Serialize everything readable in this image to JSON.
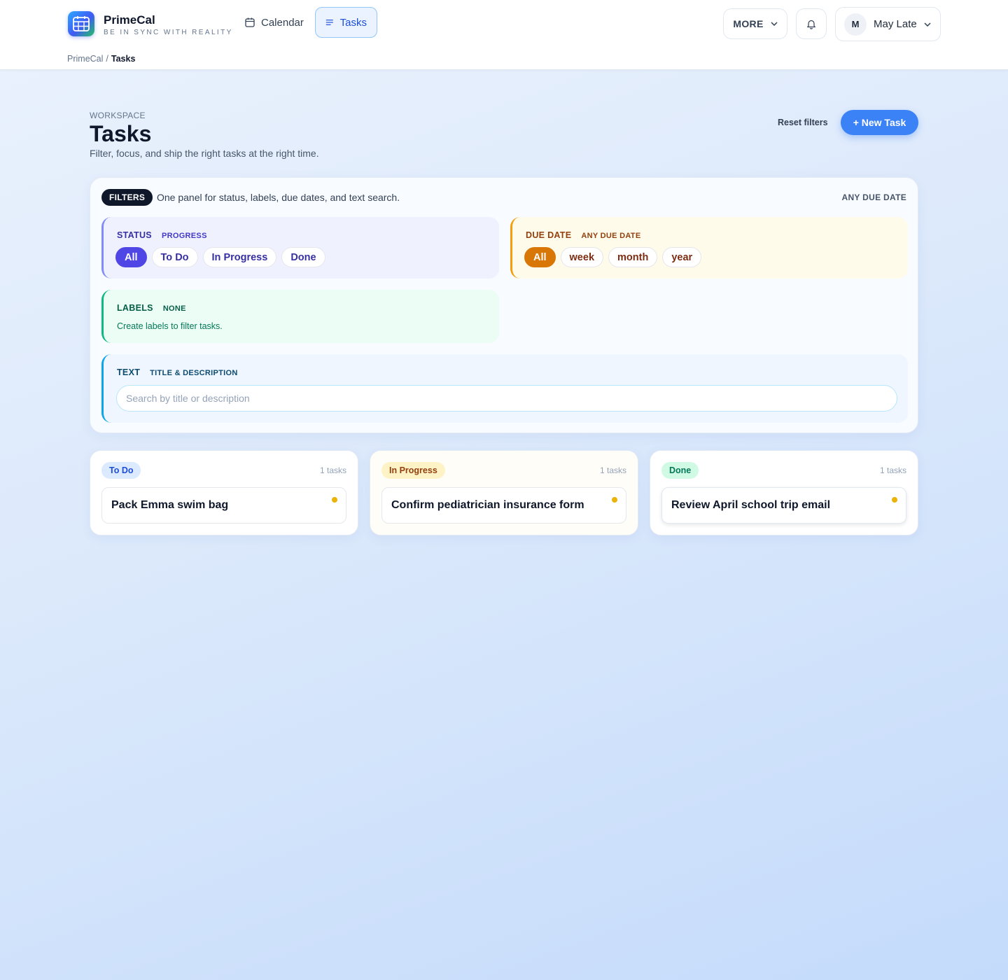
{
  "header": {
    "brand_name": "PrimeCal",
    "brand_tagline": "BE IN SYNC WITH REALITY",
    "nav": [
      {
        "label": "Calendar",
        "icon": "calendar-icon"
      },
      {
        "label": "Tasks",
        "icon": "list-icon",
        "active": true
      }
    ],
    "more_label": "MORE",
    "user": {
      "initial": "M",
      "name": "May Late"
    }
  },
  "breadcrumb": {
    "root": "PrimeCal",
    "separator": "/",
    "current": "Tasks"
  },
  "page": {
    "eyebrow": "WORKSPACE",
    "title": "Tasks",
    "subtitle": "Filter, focus, and ship the right tasks at the right time.",
    "reset_label": "Reset filters",
    "new_task_label": "+ New Task"
  },
  "filters": {
    "pill": "FILTERS",
    "description": "One panel for status, labels, due dates, and text search.",
    "summary": "ANY DUE DATE",
    "status": {
      "title": "STATUS",
      "sub": "PROGRESS",
      "options": [
        "All",
        "To Do",
        "In Progress",
        "Done"
      ],
      "selected": "All"
    },
    "due_date": {
      "title": "DUE DATE",
      "sub": "ANY DUE DATE",
      "options": [
        "All",
        "week",
        "month",
        "year"
      ],
      "selected": "All"
    },
    "labels": {
      "title": "LABELS",
      "sub": "NONE",
      "empty_text": "Create labels to filter tasks."
    },
    "text": {
      "title": "TEXT",
      "sub": "TITLE & DESCRIPTION",
      "value": "",
      "placeholder": "Search by title or description"
    }
  },
  "columns": [
    {
      "label": "To Do",
      "count": "1 tasks",
      "tasks": [
        {
          "title": "Pack Emma swim bag"
        }
      ]
    },
    {
      "label": "In Progress",
      "count": "1 tasks",
      "tasks": [
        {
          "title": "Confirm pediatrician insurance form"
        }
      ]
    },
    {
      "label": "Done",
      "count": "1 tasks",
      "tasks": [
        {
          "title": "Review April school trip email"
        }
      ]
    }
  ],
  "colors": {
    "accent": "#3b82f6",
    "status_active": "#4f46e5",
    "due_active": "#d97706",
    "priority_dot": "#eab308"
  }
}
